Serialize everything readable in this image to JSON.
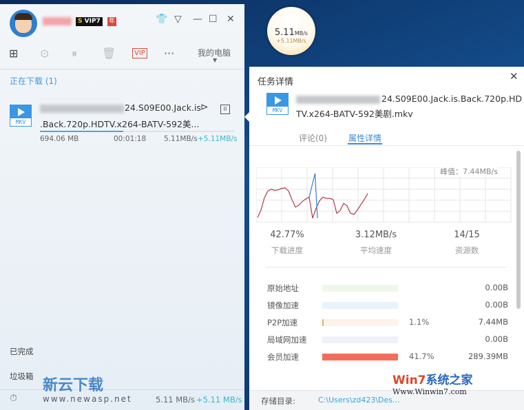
{
  "left_panel": {
    "vip_level": "VIP7",
    "vip_s": "S",
    "vip_year": "年",
    "toolbar": {
      "my_computer": "我的电脑"
    },
    "section_downloading": "正在下载 (1)",
    "task": {
      "type": "MKV",
      "name_line1": "24.S09E00.Jack.is",
      "name_line2": ".Back.720p.HDTV.x264-BATV-592美...",
      "size": "694.06 MB",
      "time_left": "00:01:18",
      "speed": "5.11MB/s",
      "accel_speed": "+5.11MB/s",
      "progress": 0.4277
    },
    "completed": "已完成",
    "trash": "垃圾箱",
    "status_speed": "5.11 MB/s",
    "status_accel": "+5.11 MB/s",
    "watermark": "新云下载 www.newasp.net"
  },
  "float_ball": {
    "speed": "5.11",
    "unit": "MB/s",
    "accel": "+5.11MB/s"
  },
  "detail": {
    "title": "任务详情",
    "file_type": "MKV",
    "name_line1": "24.S09E00.Jack.is.Back.720p.HD",
    "name_line2": "TV.x264-BATV-592美剧.mkv",
    "tabs": [
      "评论(0)",
      "属性详情"
    ],
    "peak": "峰值：7.44MB/s",
    "stats": [
      {
        "value": "42.77%",
        "label": "下载进度"
      },
      {
        "value": "3.12MB/s",
        "label": "平均速度"
      },
      {
        "value": "14/15",
        "label": "资源数"
      }
    ],
    "sources": [
      {
        "name": "原始地址",
        "percent": "",
        "fraction": 0,
        "size": "0.00B",
        "track": "#eef8ea",
        "color": "#9ad07a"
      },
      {
        "name": "镜像加速",
        "percent": "",
        "fraction": 0,
        "size": "0.00B",
        "track": "#eaf3fb",
        "color": "#7ab3e0"
      },
      {
        "name": "P2P加速",
        "percent": "1.1%",
        "fraction": 0.011,
        "size": "7.44MB",
        "track": "#fdf3e8",
        "color": "#e8b060"
      },
      {
        "name": "局域网加速",
        "percent": "",
        "fraction": 0,
        "size": "0.00B",
        "track": "#eef2fa",
        "color": "#90a8e0"
      },
      {
        "name": "会员加速",
        "percent": "41.7%",
        "fraction": 1,
        "size": "289.39MB",
        "track": "#fde8e4",
        "color": "#f26e5a"
      }
    ],
    "storage_label": "存储目录:",
    "storage_path": "C:\\Users\\zd423\\Des...",
    "watermark": "Win7系统之家 Www.Winwin7.com"
  },
  "chart_data": {
    "type": "line",
    "title": "",
    "ylim": [
      0,
      8
    ],
    "peak_label": "峰值：7.44MB/s",
    "series": [
      {
        "name": "download",
        "color": "#b03a4a",
        "values": [
          0.3,
          1.5,
          3.5,
          4.6,
          4.9,
          4.7,
          4.8,
          5.0,
          5.1,
          4.6,
          3.2,
          2.0,
          2.3,
          2.9,
          3.3,
          3.6,
          0.2,
          1.8,
          3.0,
          3.6,
          3.4,
          3.4,
          3.2,
          1.0,
          1.4,
          2.6,
          2.2,
          1.0,
          0.8,
          1.5,
          2.4,
          3.2,
          4.2
        ]
      },
      {
        "name": "accel",
        "color": "#3a7ad8",
        "spike": [
          {
            "x": 15,
            "y": 3.6
          },
          {
            "x": 16.7,
            "y": 7.44
          },
          {
            "x": 17.4,
            "y": 0.2
          }
        ]
      }
    ]
  },
  "colors": {
    "accent": "#3d9ae0",
    "vip_red": "#d84a3a"
  }
}
